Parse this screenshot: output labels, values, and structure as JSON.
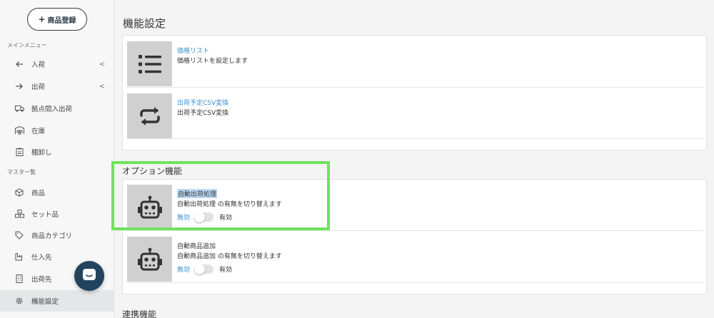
{
  "sidebar": {
    "add_button": "商品登録",
    "main_menu_label": "メインメニュー",
    "master_label": "マスター覧",
    "items": [
      {
        "label": "入荷",
        "icon": "arrow-left-icon",
        "chevron": "<"
      },
      {
        "label": "出荷",
        "icon": "arrow-right-icon",
        "chevron": "<"
      },
      {
        "label": "拠点間入出荷",
        "icon": "truck-icon"
      },
      {
        "label": "在庫",
        "icon": "warehouse-icon"
      },
      {
        "label": "棚卸し",
        "icon": "clipboard-icon"
      },
      {
        "label": "商品",
        "icon": "box-icon"
      },
      {
        "label": "セット品",
        "icon": "boxes-icon"
      },
      {
        "label": "商品カテゴリ",
        "icon": "tag-icon"
      },
      {
        "label": "仕入先",
        "icon": "factory-icon"
      },
      {
        "label": "出荷先",
        "icon": "building-icon"
      },
      {
        "label": "機能設定",
        "icon": "gear-icon",
        "active": true
      }
    ]
  },
  "main": {
    "title": "機能設定",
    "features": [
      {
        "title": "価格リスト",
        "desc": "価格リストを設定します",
        "icon": "list-icon"
      },
      {
        "title": "出荷予定CSV変換",
        "desc": "出荷予定CSV変換",
        "icon": "repeat-icon"
      }
    ],
    "options_title": "オプション機能",
    "options": [
      {
        "title": "自動出荷処理",
        "desc": "自動出荷処理 の有無を切り替えます",
        "off_label": "無効",
        "on_label": "有効",
        "icon": "robot-icon"
      },
      {
        "title": "自動商品追加",
        "desc": "自動商品追加 の有無を切り替えます",
        "off_label": "無効",
        "on_label": "有効",
        "icon": "robot-icon"
      }
    ],
    "integration_title": "連携機能"
  },
  "colors": {
    "link": "#3a8fd1",
    "highlight": "#6ee35b",
    "chat": "#23435c"
  }
}
